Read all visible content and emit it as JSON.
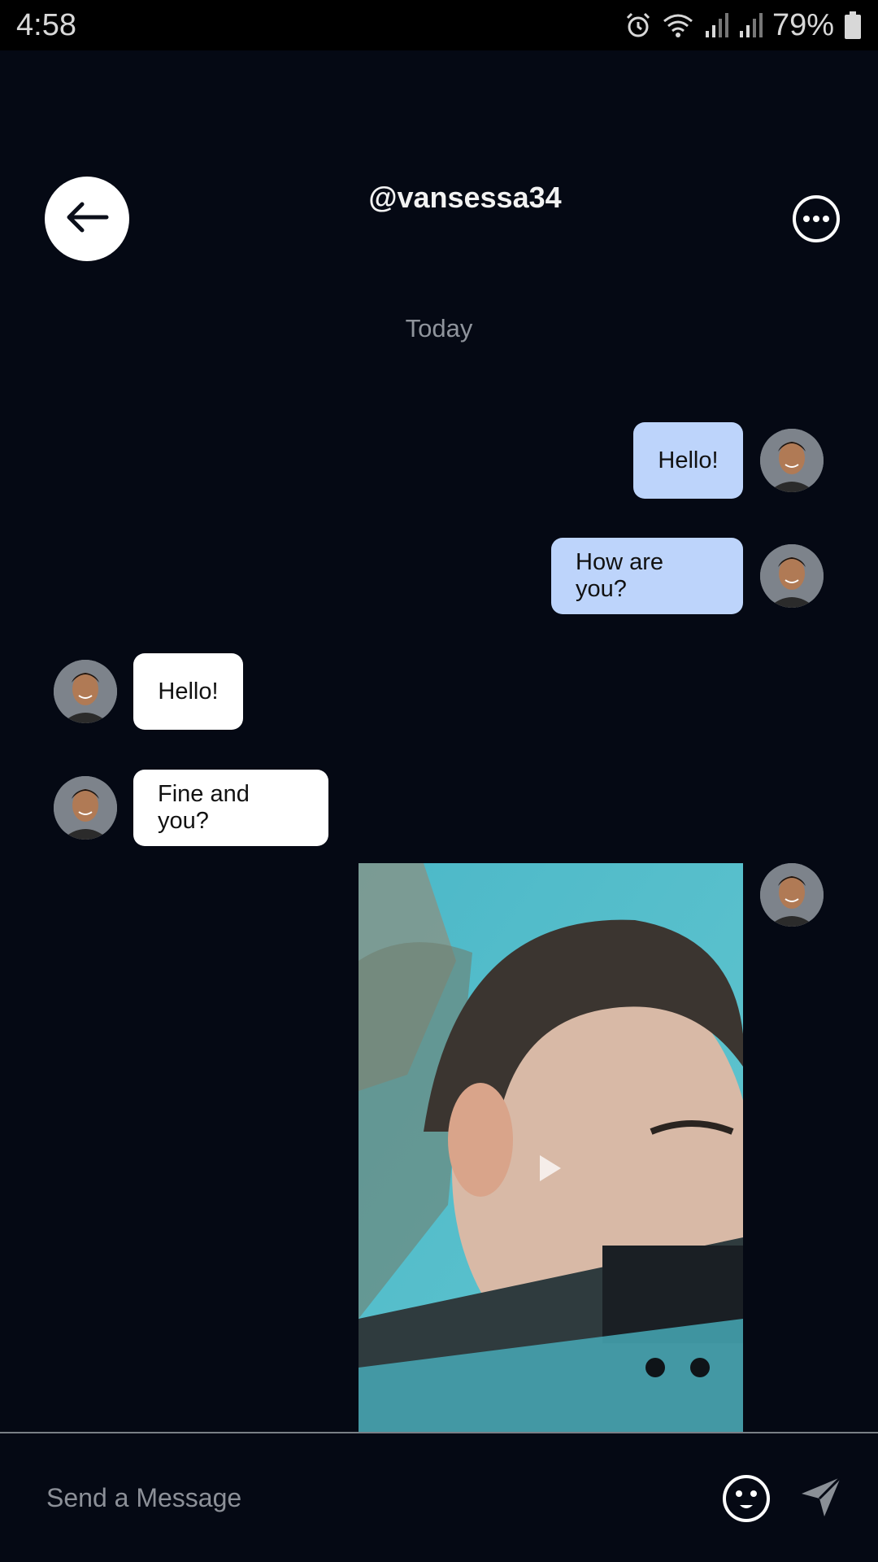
{
  "status_bar": {
    "time": "4:58",
    "battery": "79%",
    "icons": [
      "alarm-icon",
      "wifi-icon",
      "signal-icon",
      "signal-icon",
      "battery-icon"
    ]
  },
  "header": {
    "title": "@vansessa34",
    "back_icon": "arrow-left-icon",
    "more_icon": "more-horizontal-icon"
  },
  "chat": {
    "date_label": "Today",
    "messages": [
      {
        "direction": "sent",
        "text": "Hello!"
      },
      {
        "direction": "sent",
        "text": "How are you?"
      },
      {
        "direction": "received",
        "text": "Hello!"
      },
      {
        "direction": "received",
        "text": "Fine and you?"
      },
      {
        "direction": "sent",
        "type": "video"
      }
    ]
  },
  "composer": {
    "placeholder": "Send a Message",
    "emoji_icon": "smiley-icon",
    "send_icon": "send-icon"
  },
  "colors": {
    "background": "#050914",
    "sent_bubble": "#bdd4fb",
    "received_bubble": "#ffffff"
  }
}
